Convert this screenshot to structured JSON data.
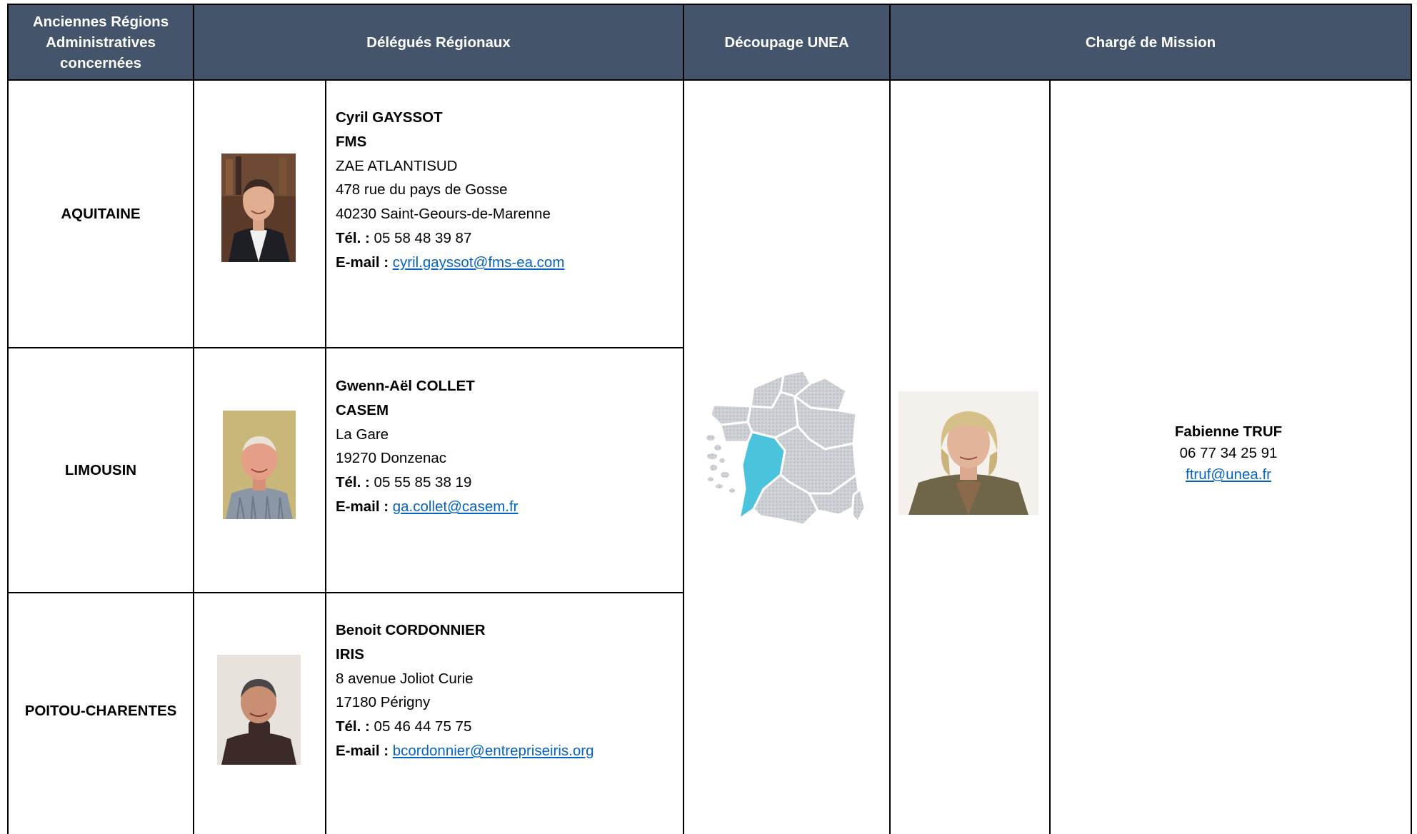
{
  "header": {
    "col_regions": "Anciennes Régions Administratives concernées",
    "col_delegues": "Délégués Régionaux",
    "col_decoupage": "Découpage UNEA",
    "col_charge": "Chargé de Mission"
  },
  "colors": {
    "header_bg": "#44546a",
    "header_text": "#ffffff",
    "link": "#0563c1",
    "map_highlight": "#4cc3dc",
    "map_base": "#cfd2d6"
  },
  "rows": [
    {
      "region": "AQUITAINE",
      "name": "Cyril GAYSSOT",
      "org": "FMS",
      "address1": "ZAE ATLANTISUD",
      "address2": "478 rue du pays de Gosse",
      "address3": "40230 Saint-Geours-de-Marenne",
      "tel_label": "Tél. :",
      "tel": "05 58 48 39 87",
      "email_label": "E-mail :",
      "email": "cyril.gayssot@fms-ea.com"
    },
    {
      "region": "LIMOUSIN",
      "name": "Gwenn-Aël COLLET",
      "org": "CASEM",
      "address1": "La Gare",
      "address2": "19270 Donzenac",
      "tel_label": "Tél. :",
      "tel": "05 55 85 38 19",
      "email_label": "E-mail :",
      "email": "ga.collet@casem.fr"
    },
    {
      "region": "POITOU-CHARENTES",
      "name": "Benoit CORDONNIER",
      "org": "IRIS",
      "address1": "8 avenue Joliot Curie",
      "address2": "17180 Périgny",
      "tel_label": "Tél. :",
      "tel": "05 46 44 75 75",
      "email_label": "E-mail :",
      "email": "bcordonnier@entrepriseiris.org"
    }
  ],
  "mission": {
    "name": "Fabienne TRUF",
    "phone": "06 77 34 25 91",
    "email": "ftruf@unea.fr"
  }
}
